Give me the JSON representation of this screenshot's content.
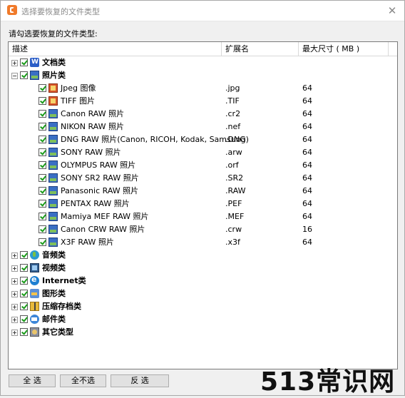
{
  "window": {
    "title": "选择要恢复的文件类型",
    "close_glyph": "✕"
  },
  "prompt": "请勾选要恢复的文件类型:",
  "columns": {
    "desc": "描述",
    "ext": "扩展名",
    "size": "最大尺寸 ( MB )"
  },
  "rows": [
    {
      "level": 0,
      "expander": "+",
      "icon": "word",
      "label": "文档类",
      "ext": "",
      "size": ""
    },
    {
      "level": 0,
      "expander": "−",
      "icon": "photo",
      "label": "照片类",
      "ext": "",
      "size": ""
    },
    {
      "level": 1,
      "icon": "photo2",
      "label": "Jpeg 图像",
      "ext": ".jpg",
      "size": "64"
    },
    {
      "level": 1,
      "icon": "photo2",
      "label": "TIFF 图片",
      "ext": ".TIF",
      "size": "64"
    },
    {
      "level": 1,
      "icon": "photo",
      "label": "Canon RAW 照片",
      "ext": ".cr2",
      "size": "64"
    },
    {
      "level": 1,
      "icon": "photo",
      "label": "NIKON RAW 照片",
      "ext": ".nef",
      "size": "64"
    },
    {
      "level": 1,
      "icon": "photo",
      "label": "DNG RAW 照片(Canon, RICOH, Kodak, Samsung)",
      "ext": ".DNG",
      "size": "64"
    },
    {
      "level": 1,
      "icon": "photo",
      "label": "SONY RAW 照片",
      "ext": ".arw",
      "size": "64"
    },
    {
      "level": 1,
      "icon": "photo",
      "label": "OLYMPUS RAW 照片",
      "ext": ".orf",
      "size": "64"
    },
    {
      "level": 1,
      "icon": "photo",
      "label": "SONY SR2 RAW 照片",
      "ext": ".SR2",
      "size": "64"
    },
    {
      "level": 1,
      "icon": "photo",
      "label": "Panasonic RAW 照片",
      "ext": ".RAW",
      "size": "64"
    },
    {
      "level": 1,
      "icon": "photo",
      "label": "PENTAX RAW 照片",
      "ext": ".PEF",
      "size": "64"
    },
    {
      "level": 1,
      "icon": "photo",
      "label": "Mamiya MEF RAW 照片",
      "ext": ".MEF",
      "size": "64"
    },
    {
      "level": 1,
      "icon": "photo",
      "label": "Canon CRW RAW 照片",
      "ext": ".crw",
      "size": "16"
    },
    {
      "level": 1,
      "icon": "photo",
      "label": "X3F RAW 照片",
      "ext": ".x3f",
      "size": "64"
    },
    {
      "level": 0,
      "expander": "+",
      "icon": "audio",
      "label": "音频类",
      "ext": "",
      "size": ""
    },
    {
      "level": 0,
      "expander": "+",
      "icon": "video",
      "label": "视频类",
      "ext": "",
      "size": ""
    },
    {
      "level": 0,
      "expander": "+",
      "icon": "ie",
      "label": "Internet类",
      "ext": "",
      "size": ""
    },
    {
      "level": 0,
      "expander": "+",
      "icon": "graph",
      "label": "图形类",
      "ext": "",
      "size": ""
    },
    {
      "level": 0,
      "expander": "+",
      "icon": "zip",
      "label": "压缩存档类",
      "ext": "",
      "size": ""
    },
    {
      "level": 0,
      "expander": "+",
      "icon": "mail",
      "label": "邮件类",
      "ext": "",
      "size": ""
    },
    {
      "level": 0,
      "expander": "+",
      "icon": "other",
      "label": "其它类型",
      "ext": "",
      "size": ""
    }
  ],
  "buttons": {
    "select_all": "全 选",
    "select_none": "全不选",
    "invert": "反 选"
  },
  "watermark": "513常识网",
  "colors": {
    "accent": "#f07a2a",
    "check": "#1a9a1a"
  }
}
